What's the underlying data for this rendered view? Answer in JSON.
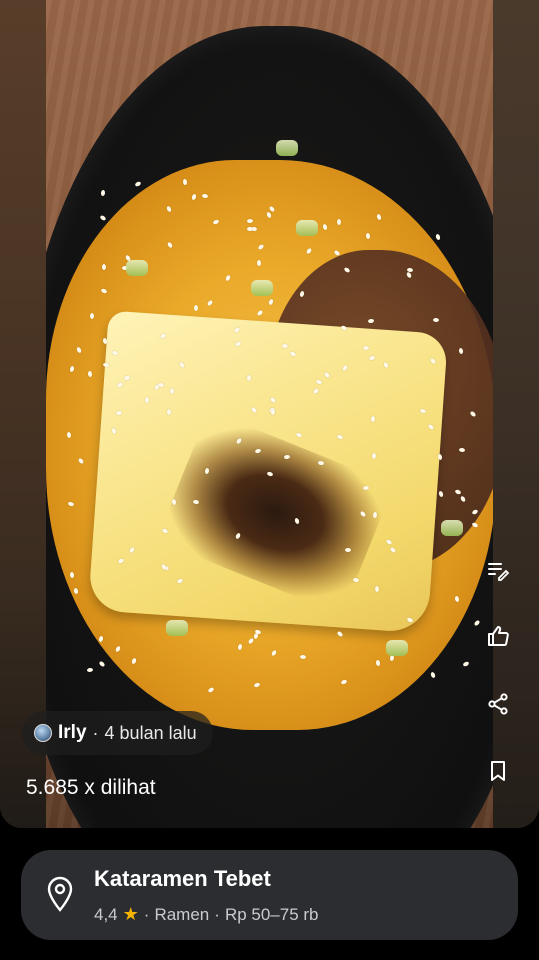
{
  "post": {
    "author_name": "Irly",
    "separator": "·",
    "posted_time": "4 bulan lalu",
    "views": "5.685 x dilihat"
  },
  "actions": [
    {
      "name": "edit-caption-icon"
    },
    {
      "name": "like-icon"
    },
    {
      "name": "share-icon"
    },
    {
      "name": "bookmark-icon"
    }
  ],
  "place": {
    "name": "Kataramen Tebet",
    "rating": "4,4",
    "rating_icon": "star-icon",
    "sep1": "·",
    "category": "Ramen",
    "sep2": "·",
    "price": "Rp 50–75 rb"
  },
  "colors": {
    "star": "#f6b400",
    "card_bg": "#2b2d30",
    "page_bg": "#000000"
  }
}
